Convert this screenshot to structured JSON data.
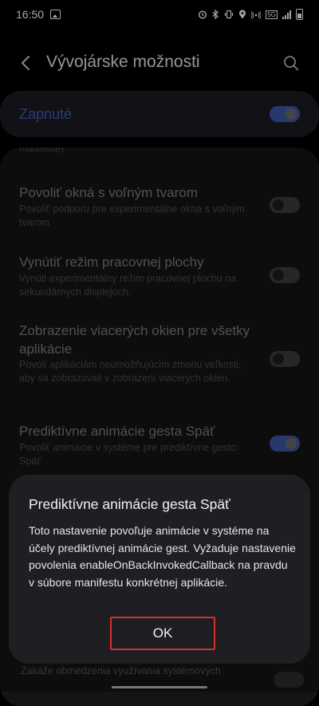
{
  "status_bar": {
    "time": "16:50",
    "network_label": "5G",
    "icons": [
      "gallery-icon",
      "alarm-icon",
      "bluetooth-icon",
      "vibrate-icon",
      "location-icon",
      "hotspot-icon",
      "lte-icon",
      "signal-icon",
      "battery-icon"
    ]
  },
  "app_bar": {
    "title": "Vývojárske možnosti",
    "icons": [
      "back-arrow-icon",
      "search-icon"
    ]
  },
  "master_switch": {
    "label": "Zapnuté",
    "state": "on",
    "accent_color": "#3d57a8"
  },
  "settings": {
    "clipped_top_text": "manifeste)",
    "items": [
      {
        "title": "Povoliť okná s voľným tvarom",
        "subtitle": "Povoliť podporu pre experimentálne okná s voľným tvarom",
        "state": "off"
      },
      {
        "title": "Vynútiť režim pracovnej plochy",
        "subtitle": "Vynúti experimentálny režim pracovnej plochu na sekundárnych displejoch.",
        "state": "off"
      },
      {
        "title": "Zobrazenie viacerých okien pre všetky aplikácie",
        "subtitle": "Povolí aplikáciám neumožňujúcim zmenu veľkosti, aby sa zobrazovali v zobrazení viacerých okien.",
        "state": "off"
      },
      {
        "title": "Prediktívne animácie gesta Späť",
        "subtitle": "Povoliť animácie v systéme pre prediktívne gesto Späť",
        "state": "on"
      }
    ],
    "bottom_text": "Zakáže obmedzenia využívania systémových"
  },
  "dialog": {
    "title": "Prediktívne animácie gesta Späť",
    "body": "Toto nastavenie povoľuje animácie v systéme na účely prediktívnej animácie gest. Vyžaduje nastavenie povolenia enableOnBackInvokedCallback na pravdu v súbore manifestu konkrétnej aplikácie.",
    "ok_label": "OK",
    "highlight_color": "#d52f2f"
  }
}
